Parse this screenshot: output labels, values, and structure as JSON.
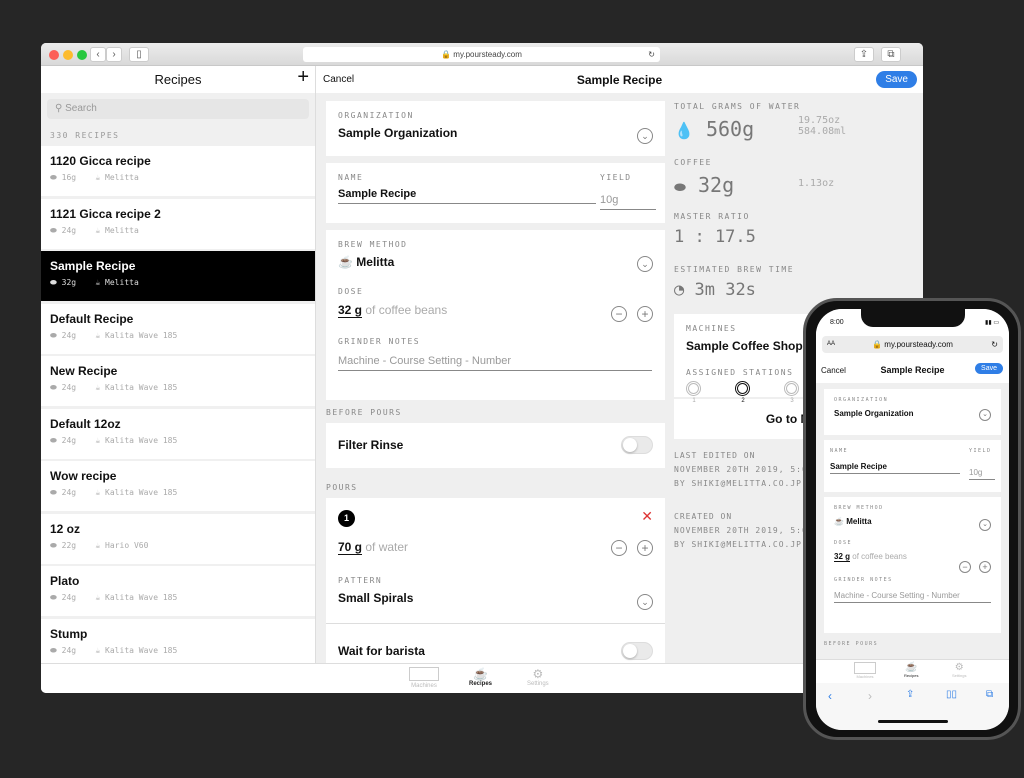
{
  "browser": {
    "url": "my.poursteady.com"
  },
  "sidebar": {
    "title": "Recipes",
    "add_label": "+",
    "search_placeholder": "Search",
    "count": "330 RECIPES",
    "items": [
      {
        "name": "1120 Gicca recipe",
        "dose": "16g",
        "method": "Melitta"
      },
      {
        "name": "1121 Gicca recipe 2",
        "dose": "24g",
        "method": "Melitta"
      },
      {
        "name": "Sample Recipe",
        "dose": "32g",
        "method": "Melitta",
        "selected": true
      },
      {
        "name": "Default Recipe",
        "dose": "24g",
        "method": "Kalita Wave 185"
      },
      {
        "name": "New Recipe",
        "dose": "24g",
        "method": "Kalita Wave 185"
      },
      {
        "name": "Default 12oz",
        "dose": "24g",
        "method": "Kalita Wave 185"
      },
      {
        "name": "Wow recipe",
        "dose": "24g",
        "method": "Kalita Wave 185"
      },
      {
        "name": "12 oz",
        "dose": "22g",
        "method": "Hario V60"
      },
      {
        "name": "Plato",
        "dose": "24g",
        "method": "Kalita Wave 185"
      },
      {
        "name": "Stump",
        "dose": "24g",
        "method": "Kalita Wave 185"
      }
    ]
  },
  "header": {
    "cancel": "Cancel",
    "title": "Sample Recipe",
    "save": "Save"
  },
  "form": {
    "organization_label": "ORGANIZATION",
    "organization": "Sample Organization",
    "name_label": "NAME",
    "name": "Sample Recipe",
    "yield_label": "YIELD",
    "yield": "10g",
    "brew_method_label": "BREW METHOD",
    "brew_method": "Melitta",
    "dose_label": "DOSE",
    "dose": "32 g",
    "dose_suffix": "of coffee beans",
    "grinder_label": "GRINDER NOTES",
    "grinder_placeholder": "Machine - Course Setting - Number",
    "before_pours": "BEFORE POURS",
    "filter_rinse": "Filter Rinse",
    "filter_rinse_on": false,
    "pours_label": "POURS",
    "pour_number": "1",
    "pour_amount": "70 g",
    "pour_suffix": "of water",
    "pattern_label": "PATTERN",
    "pattern": "Small Spirals",
    "wait_barista": "Wait for barista",
    "wait_barista_on": false
  },
  "summary": {
    "water_label": "TOTAL GRAMS OF WATER",
    "water": "560g",
    "water_oz": "19.75oz",
    "water_ml": "584.08ml",
    "coffee_label": "COFFEE",
    "coffee": "32g",
    "coffee_oz": "1.13oz",
    "ratio_label": "MASTER RATIO",
    "ratio": "1 : 17.5",
    "time_label": "ESTIMATED BREW TIME",
    "time": "3m 32s",
    "machines_label": "MACHINES",
    "machine": "Sample Coffee Shop (M",
    "stations_label": "ASSIGNED STATIONS",
    "stations": [
      "1",
      "2",
      "3"
    ],
    "selected_station": "2",
    "goto": "Go to Mach",
    "edited_label": "LAST EDITED ON",
    "edited": "NOVEMBER 20TH 2019, 5:04",
    "edited_by": "BY SHIKI@MELITTA.CO.JP",
    "created_label": "CREATED ON",
    "created": "NOVEMBER 20TH 2019, 5:04",
    "created_by": "BY SHIKI@MELITTA.CO.JP"
  },
  "tabs": [
    "Machines",
    "Recipes",
    "Settings"
  ],
  "phone": {
    "time": "8:00",
    "aa": "AA",
    "url": "my.poursteady.com"
  }
}
